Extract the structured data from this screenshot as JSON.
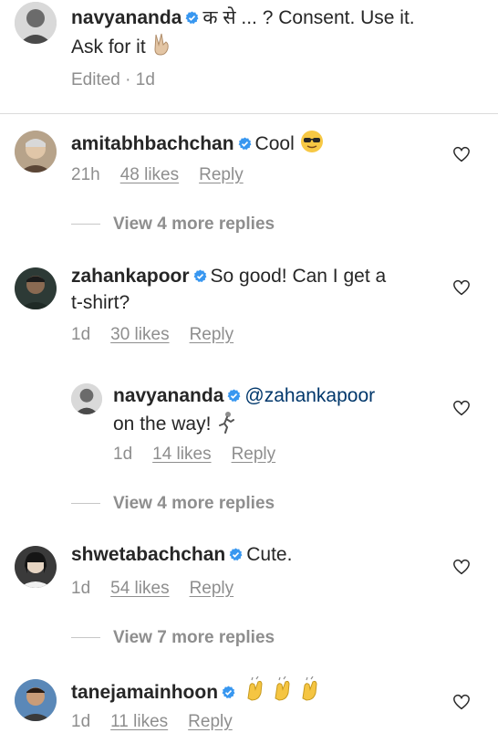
{
  "caption": {
    "username": "navyananda",
    "text_line1": "क से ... ? Consent. Use it.",
    "text_line2": "Ask for it",
    "meta": "Edited · 1d"
  },
  "comments": [
    {
      "username": "amitabhbachchan",
      "text": "Cool",
      "time": "21h",
      "likes": "48 likes",
      "reply": "Reply",
      "view_more": "View 4 more replies"
    },
    {
      "username": "zahankapoor",
      "text_line1": "So good! Can I get a",
      "text_line2": "t-shirt?",
      "time": "1d",
      "likes": "30 likes",
      "reply": "Reply",
      "reply_item": {
        "username": "navyananda",
        "mention": "@zahankapoor",
        "text_line2": "on the way!",
        "time": "1d",
        "likes": "14 likes",
        "reply": "Reply"
      },
      "view_more": "View 4 more replies"
    },
    {
      "username": "shwetabachchan",
      "text": "Cute.",
      "time": "1d",
      "likes": "54 likes",
      "reply": "Reply",
      "view_more": "View 7 more replies"
    },
    {
      "username": "tanejamainhoon",
      "time": "1d",
      "likes": "11 likes",
      "reply": "Reply"
    }
  ],
  "colors": {
    "verified_badge": "#3897f0",
    "meta_gray": "#8e8e8e",
    "mention_blue": "#00376b"
  },
  "icons": [
    "verified-badge-icon",
    "heart-outline-icon",
    "victory-hand-emoji",
    "sunglasses-emoji",
    "running-emoji",
    "clapping-hands-emoji"
  ]
}
